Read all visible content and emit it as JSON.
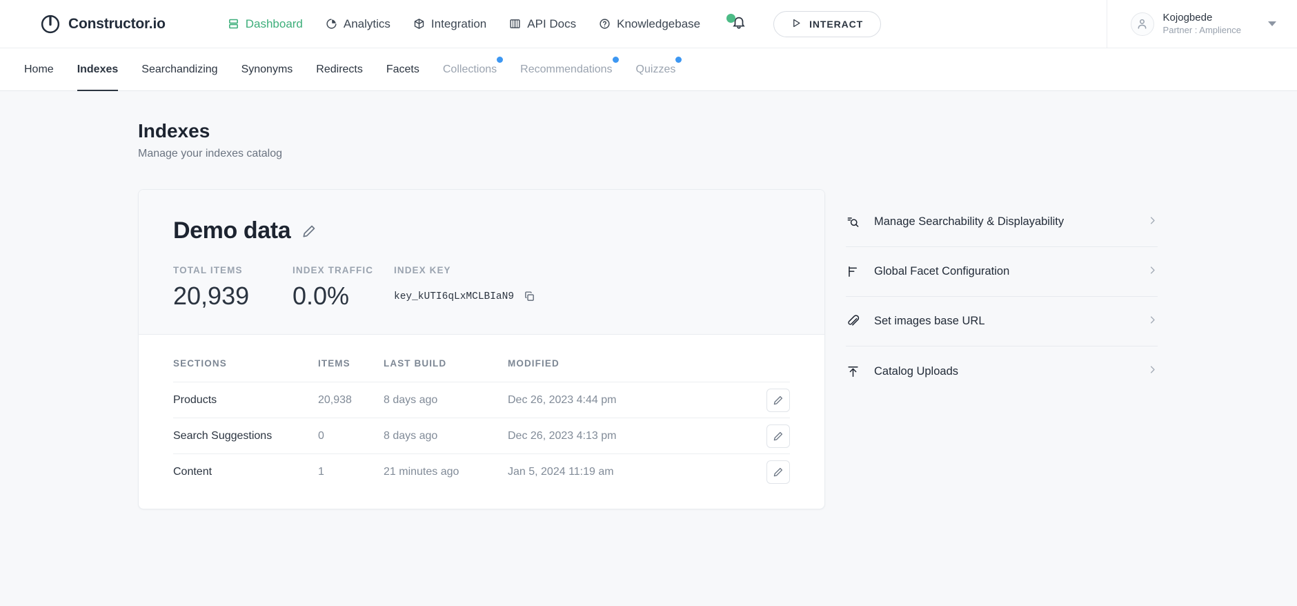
{
  "brand": {
    "name": "Constructor.io",
    "logo_icon": "power-circle-icon"
  },
  "topnav": {
    "items": [
      {
        "label": "Dashboard",
        "icon": "dashboard-icon",
        "active": true
      },
      {
        "label": "Analytics",
        "icon": "analytics-pie-icon",
        "active": false
      },
      {
        "label": "Integration",
        "icon": "integration-box-icon",
        "active": false
      },
      {
        "label": "API Docs",
        "icon": "book-icon",
        "active": false
      },
      {
        "label": "Knowledgebase",
        "icon": "question-circle-icon",
        "active": false
      }
    ],
    "notifications_icon": "bell-icon",
    "interact_button": "INTERACT",
    "interact_icon": "play-icon",
    "accent_green": "#3dae7a",
    "badge_green": "#4cbb86"
  },
  "profile": {
    "avatar_icon": "user-avatar-icon",
    "name": "Kojogbede",
    "role": "Partner : Amplience",
    "caret_icon": "chevron-down-icon"
  },
  "subnav": {
    "items": [
      {
        "label": "Home",
        "state": "default",
        "dot": false
      },
      {
        "label": "Indexes",
        "state": "active",
        "dot": false
      },
      {
        "label": "Searchandizing",
        "state": "default",
        "dot": false
      },
      {
        "label": "Synonyms",
        "state": "default",
        "dot": false
      },
      {
        "label": "Redirects",
        "state": "default",
        "dot": false
      },
      {
        "label": "Facets",
        "state": "default",
        "dot": false
      },
      {
        "label": "Collections",
        "state": "muted",
        "dot": true
      },
      {
        "label": "Recommendations",
        "state": "muted",
        "dot": true
      },
      {
        "label": "Quizzes",
        "state": "muted",
        "dot": true
      }
    ],
    "dot_color": "#3d97f2"
  },
  "page": {
    "title": "Indexes",
    "subtitle": "Manage your indexes catalog"
  },
  "index_card": {
    "name": "Demo data",
    "edit_icon": "pencil-icon",
    "stats": {
      "total_items_label": "TOTAL ITEMS",
      "total_items_value": "20,939",
      "index_traffic_label": "INDEX TRAFFIC",
      "index_traffic_value": "0.0%",
      "index_key_label": "INDEX KEY",
      "index_key_value": "key_kUTI6qLxMCLBIaN9",
      "copy_icon": "copy-icon"
    },
    "table": {
      "headers": {
        "sections": "SECTIONS",
        "items": "ITEMS",
        "last_build": "LAST BUILD",
        "modified": "MODIFIED"
      },
      "rows": [
        {
          "section": "Products",
          "items": "20,938",
          "last_build": "8 days ago",
          "modified": "Dec 26, 2023 4:44 pm",
          "edit_icon": "pencil-icon"
        },
        {
          "section": "Search Suggestions",
          "items": "0",
          "last_build": "8 days ago",
          "modified": "Dec 26, 2023 4:13 pm",
          "edit_icon": "pencil-icon"
        },
        {
          "section": "Content",
          "items": "1",
          "last_build": "21 minutes ago",
          "modified": "Jan 5, 2024 11:19 am",
          "edit_icon": "pencil-icon"
        }
      ]
    }
  },
  "side_menu": {
    "items": [
      {
        "label": "Manage Searchability & Displayability",
        "icon": "search-settings-icon",
        "chevron": "chevron-right-icon"
      },
      {
        "label": "Global Facet Configuration",
        "icon": "facet-filter-icon",
        "chevron": "chevron-right-icon"
      },
      {
        "label": "Set images base URL",
        "icon": "link-paperclip-icon",
        "chevron": "chevron-right-icon"
      },
      {
        "label": "Catalog Uploads",
        "icon": "upload-icon",
        "chevron": "chevron-right-icon"
      }
    ]
  }
}
